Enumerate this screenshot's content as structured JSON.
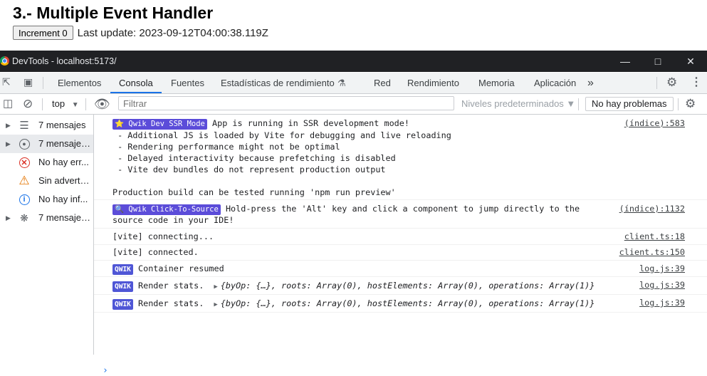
{
  "page": {
    "title": "3.- Multiple Event Handler",
    "increment_label": "Increment 0",
    "last_update": "Last update: 2023-09-12T04:00:38.119Z"
  },
  "devtools": {
    "window_title": "DevTools - localhost:5173/",
    "tabs": [
      "Elementos",
      "Consola",
      "Fuentes",
      "Estadísticas de rendimiento",
      "Red",
      "Rendimiento",
      "Memoria",
      "Aplicación"
    ],
    "active_tab": "Consola",
    "more_tabs": "»",
    "toolbar": {
      "context": "top",
      "filter_placeholder": "Filtrar",
      "levels": "Niveles predeterminados ▼",
      "issues": "No hay problemas"
    },
    "sidebar": [
      {
        "label": "7 mensajes",
        "icon": "list-icon",
        "expandable": true
      },
      {
        "label": "7 mensajes...",
        "icon": "user-icon",
        "expandable": true,
        "selected": true
      },
      {
        "label": "No hay err...",
        "icon": "error-icon",
        "expandable": false
      },
      {
        "label": "Sin adverte...",
        "icon": "warning-icon",
        "expandable": false
      },
      {
        "label": "No hay inf...",
        "icon": "info-icon",
        "expandable": false
      },
      {
        "label": "7 mensajes...",
        "icon": "bug-icon",
        "expandable": true
      }
    ],
    "console": {
      "messages": [
        {
          "badge": "⭐ Qwik Dev SSR Mode",
          "text": "App is running in SSR development mode!",
          "extra": [
            " - Additional JS is loaded by Vite for debugging and live reloading",
            " - Rendering performance might not be optimal",
            " - Delayed interactivity because prefetching is disabled",
            " - Vite dev bundles do not represent production output",
            "",
            "Production build can be tested running 'npm run preview'"
          ],
          "source": "(índice):583"
        },
        {
          "badge": "🔍 Qwik Click-To-Source",
          "text": "Hold-press the 'Alt' key and click a component to jump directly to the",
          "extra": [
            "source code in your IDE!"
          ],
          "source": "(índice):1132"
        },
        {
          "text": "[vite] connecting...",
          "source": "client.ts:18"
        },
        {
          "text": "[vite] connected.",
          "source": "client.ts:150"
        },
        {
          "badge": "QWIK",
          "text": "Container resumed",
          "source": "log.js:39"
        },
        {
          "badge": "QWIK",
          "text": "Render stats.",
          "object": "{byOp: {…}, roots: Array(0), hostElements: Array(0), operations: Array(1)}",
          "source": "log.js:39"
        },
        {
          "badge": "QWIK",
          "text": "Render stats.",
          "object": "{byOp: {…}, roots: Array(0), hostElements: Array(0), operations: Array(1)}",
          "source": "log.js:39"
        }
      ],
      "prompt": "›"
    }
  }
}
